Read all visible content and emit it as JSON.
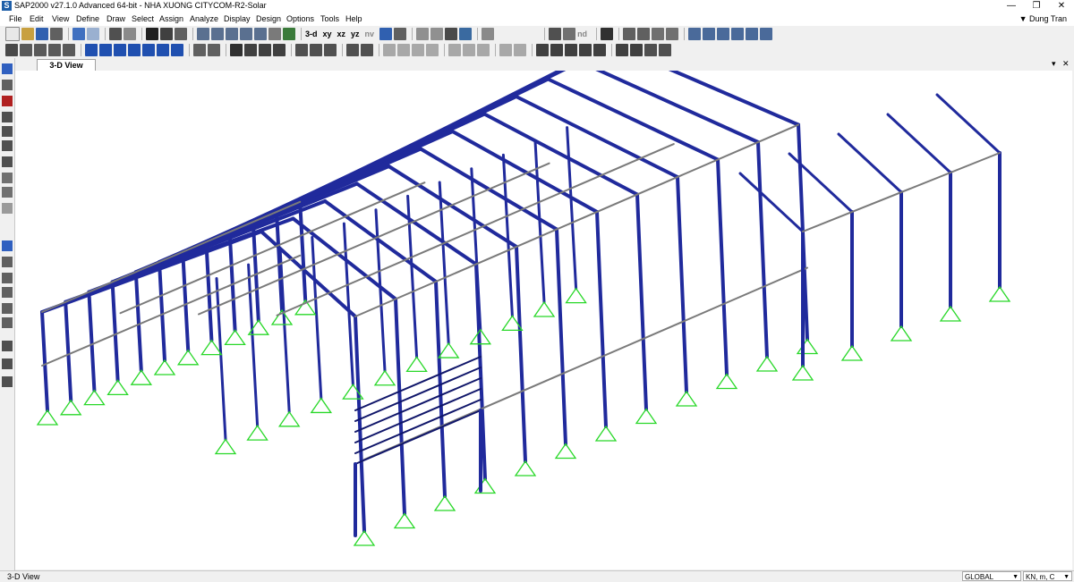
{
  "window": {
    "title": "SAP2000 v27.1.0 Advanced 64-bit - NHA XUONG CITYCOM-R2-Solar",
    "app_icon_letter": "S",
    "minimize": "—",
    "maximize": "❐",
    "close": "✕"
  },
  "menu": {
    "items": [
      "File",
      "Edit",
      "View",
      "Define",
      "Draw",
      "Select",
      "Assign",
      "Analyze",
      "Display",
      "Design",
      "Options",
      "Tools",
      "Help"
    ],
    "user": "▼ Dung Tran"
  },
  "toolbar": {
    "view_buttons": [
      "3-d",
      "xy",
      "xz",
      "yz",
      "nv"
    ],
    "nd_label": "nd"
  },
  "tab": {
    "label": "3-D View",
    "controls": [
      "▾",
      "✕"
    ]
  },
  "status": {
    "view_name": "3-D View",
    "coord_system": "GLOBAL",
    "units": "KN, m, C"
  },
  "colors": {
    "frame": "#202a9c",
    "frame_dark": "#10166a",
    "secondary": "#7a7a7a",
    "bracing": "#a8a8a8",
    "support": "#28d828",
    "accent": "#00c8ff"
  }
}
